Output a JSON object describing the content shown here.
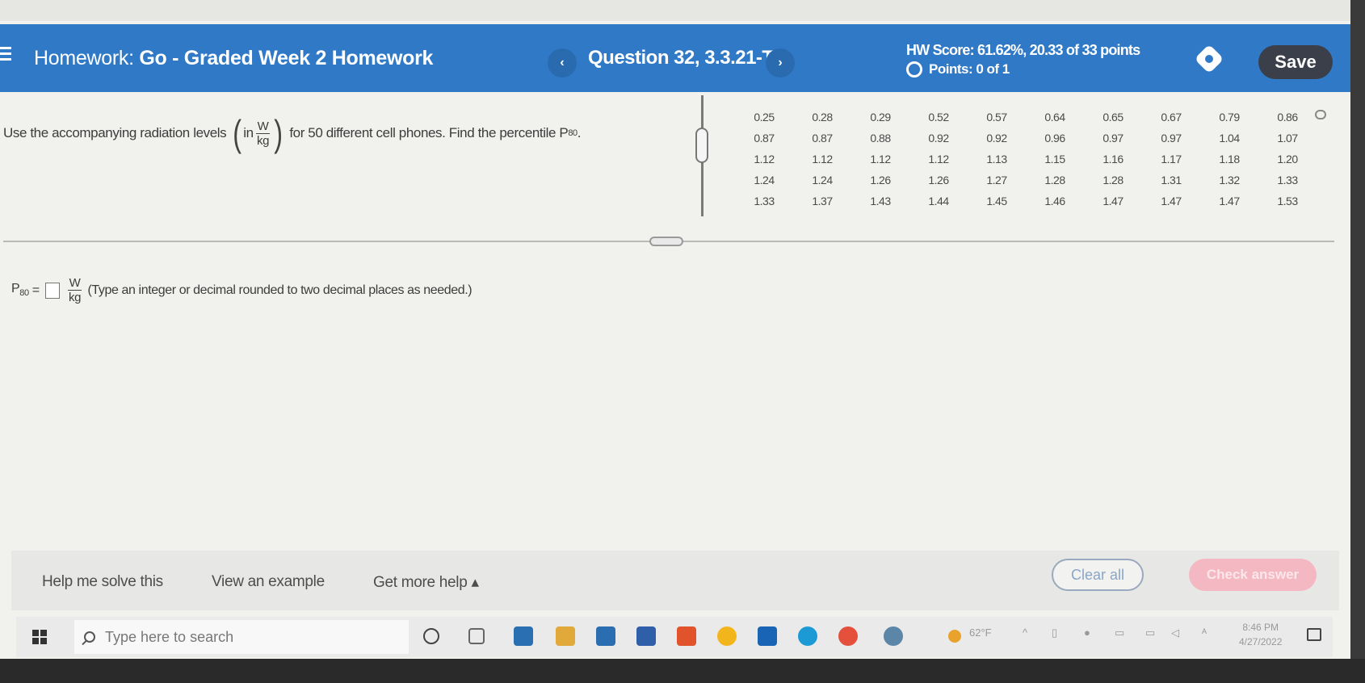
{
  "header": {
    "homework_prefix": "Homework:",
    "homework_title": "Go - Graded Week 2 Homework",
    "prev_symbol": "‹",
    "question_label": "Question 32, 3.3.21-T",
    "next_symbol": "›",
    "hw_score": "HW Score: 61.62%, 20.33 of 33 points",
    "points": "Points: 0 of 1",
    "save_label": "Save",
    "accent_color": "#2f79c6"
  },
  "question": {
    "text_before": "Use the accompanying radiation levels",
    "unit_prefix": "in",
    "unit_num": "W",
    "unit_den": "kg",
    "text_after": "for 50 different cell phones. Find the percentile P",
    "percentile_sub": "80",
    "text_end": "."
  },
  "data_rows": [
    [
      "0.25",
      "0.28",
      "0.29",
      "0.52",
      "0.57",
      "0.64",
      "0.65",
      "0.67",
      "0.79",
      "0.86"
    ],
    [
      "0.87",
      "0.87",
      "0.88",
      "0.92",
      "0.92",
      "0.96",
      "0.97",
      "0.97",
      "1.04",
      "1.07"
    ],
    [
      "1.12",
      "1.12",
      "1.12",
      "1.12",
      "1.13",
      "1.15",
      "1.16",
      "1.17",
      "1.18",
      "1.20"
    ],
    [
      "1.24",
      "1.24",
      "1.26",
      "1.26",
      "1.27",
      "1.28",
      "1.28",
      "1.31",
      "1.32",
      "1.33"
    ],
    [
      "1.33",
      "1.37",
      "1.43",
      "1.44",
      "1.45",
      "1.46",
      "1.47",
      "1.47",
      "1.47",
      "1.53"
    ]
  ],
  "answer": {
    "label": "P",
    "label_sub": "80",
    "equals": "=",
    "unit_num": "W",
    "unit_den": "kg",
    "hint": "(Type an integer or decimal rounded to two decimal places as needed.)"
  },
  "footer": {
    "help_me_solve": "Help me solve this",
    "view_example": "View an example",
    "get_more_help": "Get more help ▴",
    "clear_all": "Clear all",
    "check_answer": "Check answer"
  },
  "taskbar": {
    "search_placeholder": "Type here to search",
    "temperature": "62°F",
    "time": "8:46 PM",
    "date": "4/27/2022"
  }
}
